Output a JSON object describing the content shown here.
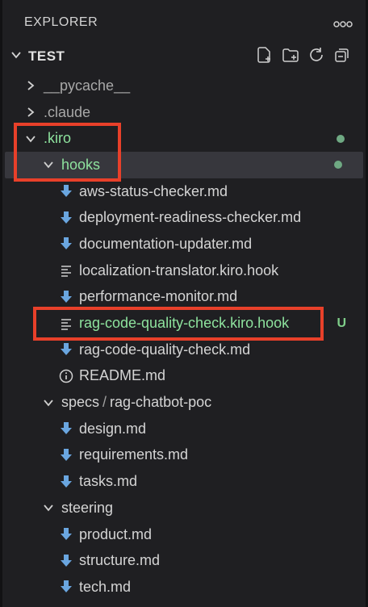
{
  "header": {
    "title": "EXPLORER",
    "more_label": "ooo"
  },
  "root": {
    "label": "TEST"
  },
  "tree": [
    {
      "name": "pycache",
      "label": "__pycache__",
      "depth": 0,
      "kind": "folder",
      "expanded": false,
      "muted": true
    },
    {
      "name": "claude",
      "label": ".claude",
      "depth": 0,
      "kind": "folder",
      "expanded": false,
      "muted": true
    },
    {
      "name": "kiro",
      "label": ".kiro",
      "depth": 0,
      "kind": "folder",
      "expanded": true,
      "color": "green",
      "dot": true
    },
    {
      "name": "hooks",
      "label": "hooks",
      "depth": 1,
      "kind": "folder",
      "expanded": true,
      "color": "green",
      "dot": true,
      "selected": true
    },
    {
      "name": "aws-status-checker",
      "label": "aws-status-checker.md",
      "depth": 2,
      "kind": "md"
    },
    {
      "name": "deployment-readiness-checker",
      "label": "deployment-readiness-checker.md",
      "depth": 2,
      "kind": "md"
    },
    {
      "name": "documentation-updater",
      "label": "documentation-updater.md",
      "depth": 2,
      "kind": "md"
    },
    {
      "name": "localization-translator",
      "label": "localization-translator.kiro.hook",
      "depth": 2,
      "kind": "hook"
    },
    {
      "name": "performance-monitor",
      "label": "performance-monitor.md",
      "depth": 2,
      "kind": "md"
    },
    {
      "name": "rag-code-quality-check-hook",
      "label": "rag-code-quality-check.kiro.hook",
      "depth": 2,
      "kind": "hook",
      "color": "green",
      "badge": "U"
    },
    {
      "name": "rag-code-quality-check-md",
      "label": "rag-code-quality-check.md",
      "depth": 2,
      "kind": "md"
    },
    {
      "name": "readme",
      "label": "README.md",
      "depth": 2,
      "kind": "info"
    },
    {
      "name": "specs",
      "label": "specs",
      "label2": "rag-chatbot-poc",
      "sep": "/",
      "depth": 1,
      "kind": "folder",
      "expanded": true
    },
    {
      "name": "design",
      "label": "design.md",
      "depth": 2,
      "kind": "md"
    },
    {
      "name": "requirements",
      "label": "requirements.md",
      "depth": 2,
      "kind": "md"
    },
    {
      "name": "tasks",
      "label": "tasks.md",
      "depth": 2,
      "kind": "md"
    },
    {
      "name": "steering",
      "label": "steering",
      "depth": 1,
      "kind": "folder",
      "expanded": true
    },
    {
      "name": "product",
      "label": "product.md",
      "depth": 2,
      "kind": "md"
    },
    {
      "name": "structure",
      "label": "structure.md",
      "depth": 2,
      "kind": "md"
    },
    {
      "name": "tech",
      "label": "tech.md",
      "depth": 2,
      "kind": "md"
    }
  ],
  "colors": {
    "accent_green": "#8ee39e",
    "md_icon": "#6aa6e0",
    "highlight": "#e8402a"
  }
}
